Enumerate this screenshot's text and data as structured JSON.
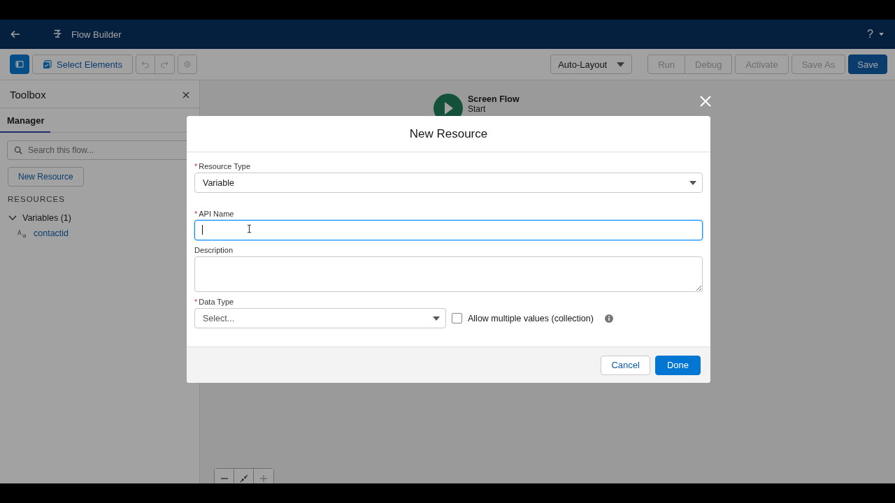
{
  "header": {
    "title": "Flow Builder",
    "help": "?"
  },
  "toolbar": {
    "select_elements": "Select Elements",
    "layout": "Auto-Layout",
    "actions": [
      {
        "label": "Run",
        "kind": "plain",
        "disabled": true
      },
      {
        "label": "Debug",
        "kind": "plain",
        "disabled": true
      },
      {
        "label": "Activate",
        "kind": "plain",
        "disabled": true
      },
      {
        "label": "Save As",
        "kind": "plain",
        "disabled": true
      },
      {
        "label": "Save",
        "kind": "primary",
        "disabled": false
      }
    ]
  },
  "toolbox": {
    "title": "Toolbox",
    "tabs": [
      {
        "label": "Manager",
        "selected": true
      }
    ],
    "search": {
      "placeholder": "Search this flow..."
    },
    "new_button": "New Resource",
    "section": "RESOURCES",
    "tree": [
      {
        "label": "Variables (1)",
        "expanded": true,
        "children": [
          {
            "label": "contactid"
          }
        ]
      }
    ]
  },
  "canvas": {
    "start_node": {
      "title": "Screen Flow",
      "subtitle": "Start"
    }
  },
  "modal": {
    "title": "New Resource",
    "fields": [
      {
        "kind": "select",
        "label": "Resource Type",
        "marker": "*",
        "value": "Variable"
      },
      {
        "kind": "text",
        "label": "API Name",
        "marker": "*",
        "focused": true
      },
      {
        "kind": "textarea",
        "label": "Description"
      }
    ],
    "data_type": {
      "label": "Data Type",
      "marker": "*",
      "placeholder": "Select..."
    },
    "collection": {
      "label": "Allow multiple values (collection)",
      "checked": false
    },
    "buttons": [
      {
        "label": "Cancel",
        "kind": "neutral"
      },
      {
        "label": "Done",
        "kind": "brand"
      }
    ]
  }
}
